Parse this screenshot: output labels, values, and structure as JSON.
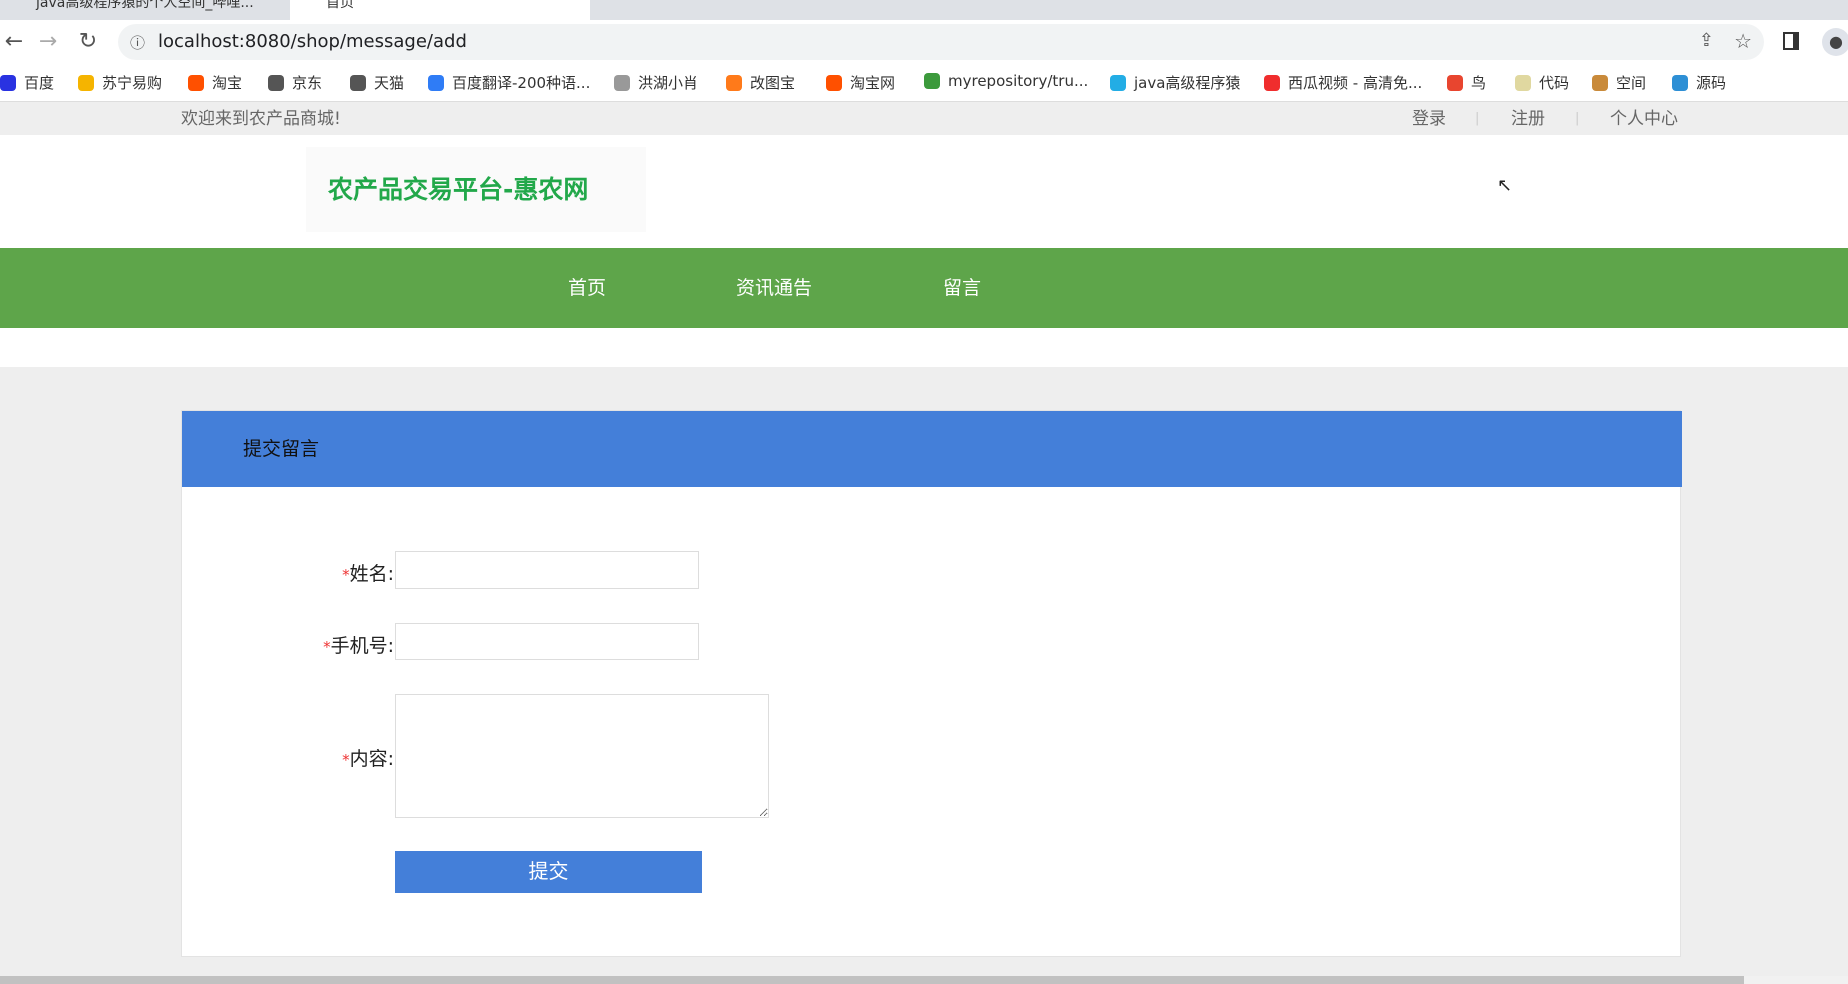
{
  "browser": {
    "tabs": [
      {
        "label": "java高级程序猿的个人空间_哔哩..."
      },
      {
        "label": "首页"
      }
    ],
    "url": "localhost:8080/shop/message/add",
    "bookmarks": [
      {
        "label": "百度",
        "color": "#2932e1"
      },
      {
        "label": "苏宁易购",
        "color": "#f5b400"
      },
      {
        "label": "淘宝",
        "color": "#ff5000"
      },
      {
        "label": "京东",
        "color": "#555555"
      },
      {
        "label": "天猫",
        "color": "#555555"
      },
      {
        "label": "百度翻译-200种语...",
        "color": "#2f7cf6"
      },
      {
        "label": "洪湖小肖",
        "color": "#999999"
      },
      {
        "label": "改图宝",
        "color": "#ff7a1a"
      },
      {
        "label": "淘宝网",
        "color": "#ff5000"
      },
      {
        "label": "myrepository/tru...",
        "color": "#3c9a3c"
      },
      {
        "label": "java高级程序猿",
        "color": "#23ade5"
      },
      {
        "label": "西瓜视频 - 高清免...",
        "color": "#f02d2d"
      },
      {
        "label": "鸟",
        "color": "#e8452f"
      },
      {
        "label": "代码",
        "color": "#e0d8a0"
      },
      {
        "label": "空间",
        "color": "#c98a3a"
      },
      {
        "label": "源码",
        "color": "#2d8fd5"
      }
    ]
  },
  "topbar": {
    "welcome": "欢迎来到农产品商城!",
    "links": [
      "登录",
      "注册",
      "个人中心"
    ],
    "separator": "|"
  },
  "header": {
    "logo_text": "农产品交易平台-惠农网"
  },
  "nav": {
    "items": [
      "首页",
      "资讯通告",
      "留言"
    ],
    "color": "#5ea54a"
  },
  "panel": {
    "title": "提交留言",
    "accent": "#447fd9"
  },
  "form": {
    "required_mark": "*",
    "name_label": "姓名:",
    "name_value": "",
    "phone_label": "手机号:",
    "phone_value": "",
    "content_label": "内容:",
    "content_value": "",
    "submit_label": "提交"
  }
}
